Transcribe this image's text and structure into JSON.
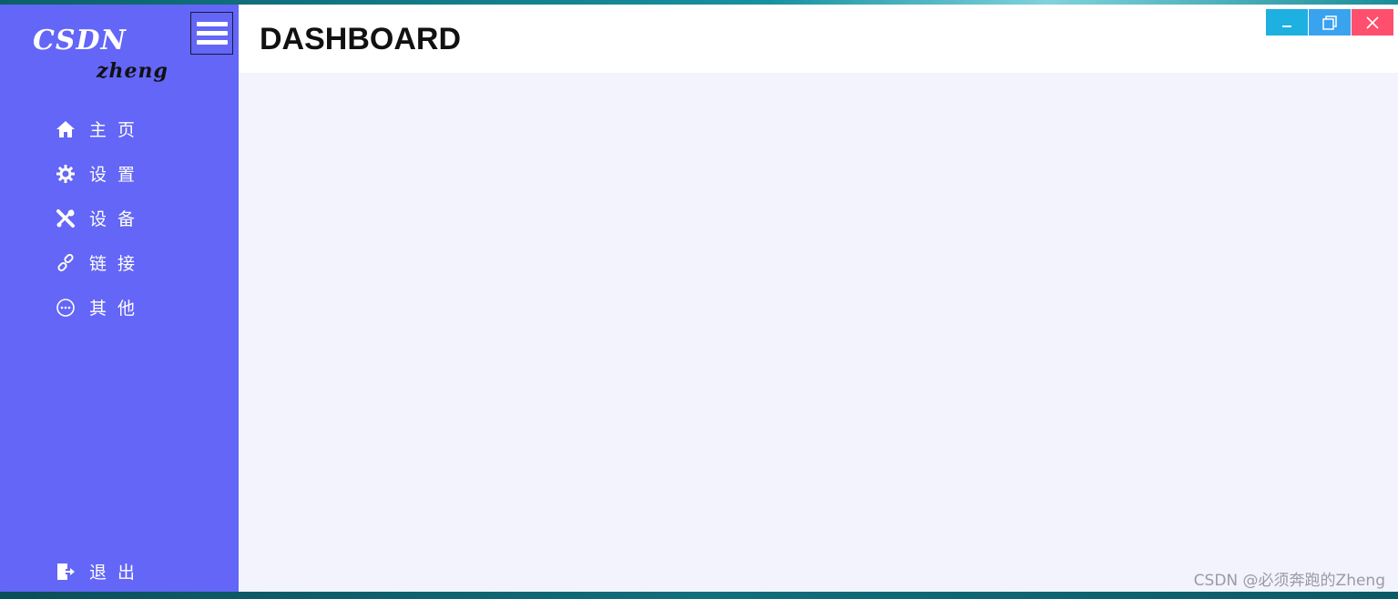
{
  "sidebar": {
    "logo_top": "CSDN",
    "logo_bottom": "zheng",
    "items": [
      {
        "label": "主页",
        "icon": "home-icon"
      },
      {
        "label": "设置",
        "icon": "gear-icon"
      },
      {
        "label": "设备",
        "icon": "tools-icon"
      },
      {
        "label": "链接",
        "icon": "link-icon"
      },
      {
        "label": "其他",
        "icon": "more-icon"
      }
    ],
    "exit_label": "退出",
    "exit_icon": "exit-icon",
    "toggle_icon": "hamburger-icon"
  },
  "header": {
    "title": "DASHBOARD"
  },
  "window_controls": {
    "minimize_icon": "minimize-icon",
    "maximize_icon": "restore-icon",
    "close_icon": "close-icon"
  },
  "watermark": "CSDN @必须奔跑的Zheng",
  "colors": {
    "sidebar": "#6366f6",
    "content_bg": "#f3f3fd",
    "minimize": "#1db0e0",
    "maximize": "#3aa3f0",
    "close": "#ff4f6e"
  }
}
